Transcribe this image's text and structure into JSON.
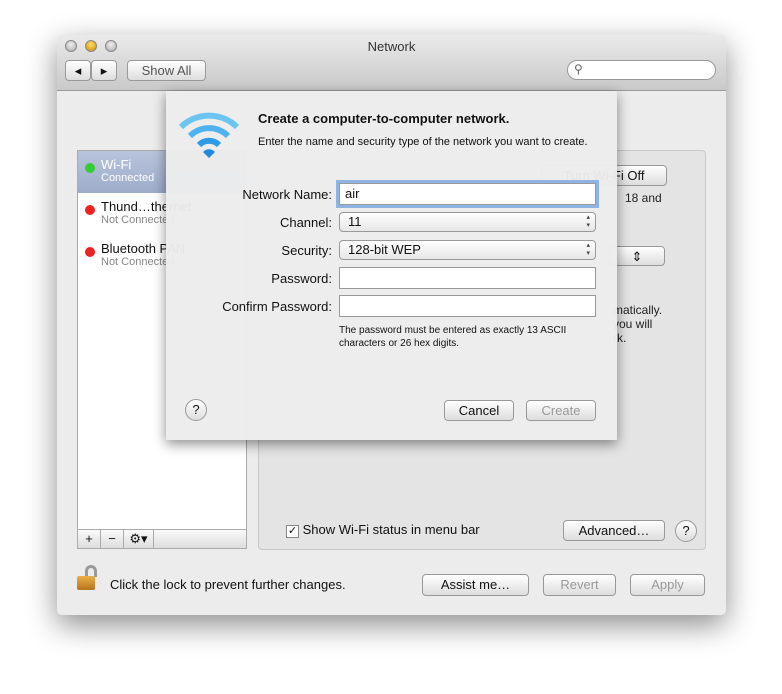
{
  "window": {
    "title": "Network",
    "show_all": "Show All"
  },
  "sidebar": {
    "items": [
      {
        "name": "Wi-Fi",
        "status": "Connected",
        "color": "#3c3"
      },
      {
        "name": "Thund…thernet",
        "status": "Not Connected",
        "color": "#e22"
      },
      {
        "name": "Bluetooth PAN",
        "status": "Not Connected",
        "color": "#e22"
      }
    ],
    "add": "+",
    "remove": "−",
    "gear": "⚙▾"
  },
  "panel": {
    "turn_off": "Turn Wi-Fi Off",
    "partial1": "18 and",
    "partial2": "matically.",
    "partial3": "you will",
    "partial4": "rk.",
    "show_status": "Show Wi-Fi status in menu bar",
    "advanced": "Advanced…",
    "help": "?"
  },
  "footer": {
    "lock_text": "Click the lock to prevent further changes.",
    "assist": "Assist me…",
    "revert": "Revert",
    "apply": "Apply"
  },
  "sheet": {
    "title": "Create a computer-to-computer network.",
    "description": "Enter the name and security type of the network you want to create.",
    "network_name_label": "Network Name:",
    "network_name": "air",
    "channel_label": "Channel:",
    "channel": "11",
    "security_label": "Security:",
    "security": "128-bit WEP",
    "password_label": "Password:",
    "password": "",
    "confirm_label": "Confirm Password:",
    "confirm": "",
    "hint": "The password must be entered as exactly 13 ASCII characters or 26 hex digits.",
    "cancel": "Cancel",
    "create": "Create",
    "help": "?"
  }
}
